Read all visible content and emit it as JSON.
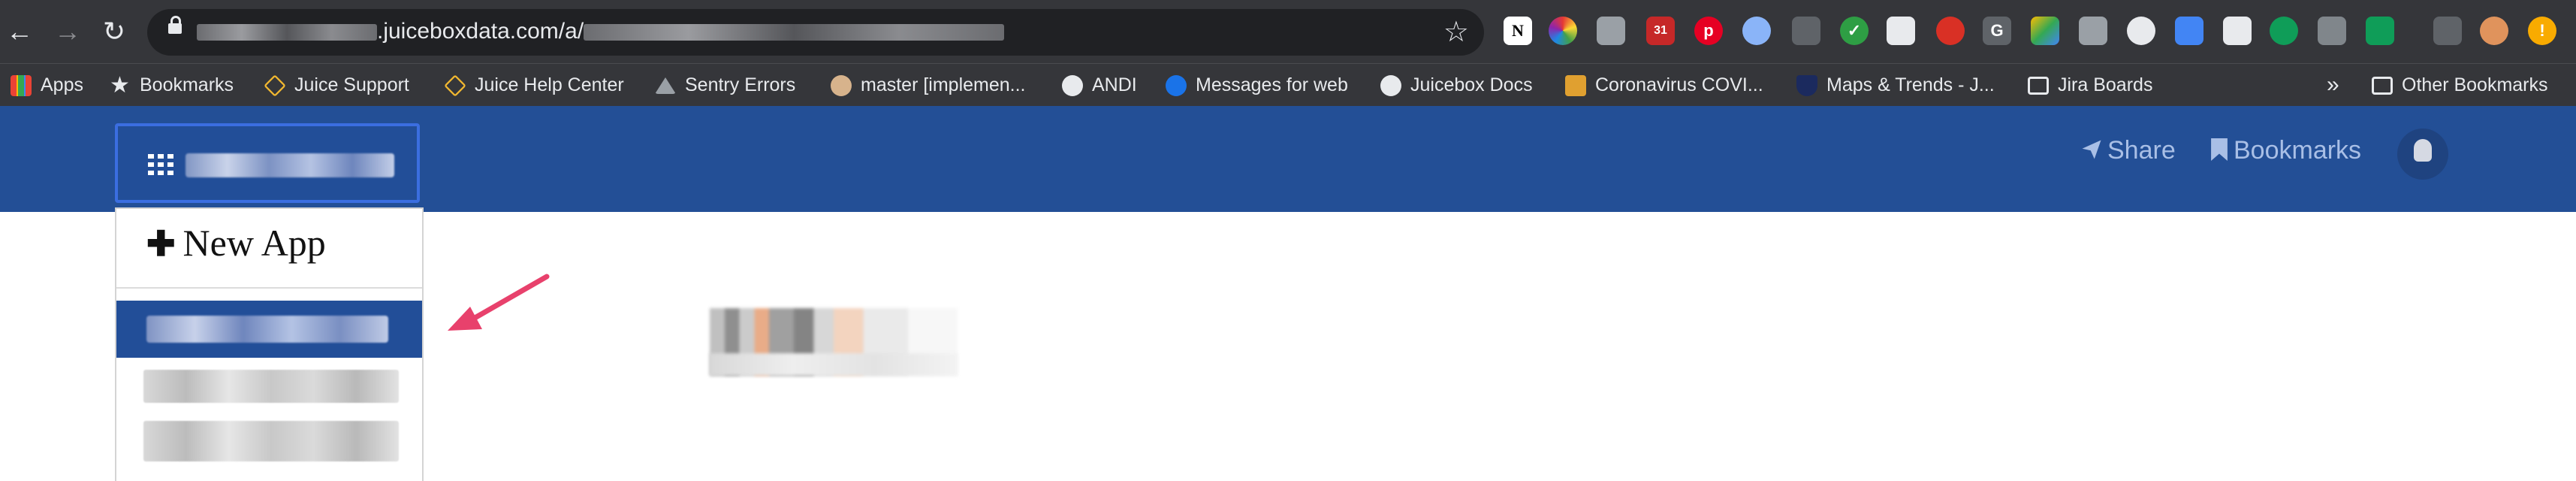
{
  "browser": {
    "url_visible": ".juiceboxdata.com/a/",
    "nav": {
      "back": "←",
      "forward": "→",
      "reload": "↻"
    },
    "star_icon": "☆"
  },
  "bookmarks": [
    {
      "label": "Apps",
      "icon": "apps-grid-icon"
    },
    {
      "label": "Bookmarks",
      "icon": "star-icon"
    },
    {
      "label": "Juice Support",
      "icon": "juice-diamond-icon"
    },
    {
      "label": "Juice Help Center",
      "icon": "juice-diamond-icon"
    },
    {
      "label": "Sentry Errors",
      "icon": "sentry-icon"
    },
    {
      "label": "master [implemen...",
      "icon": "jenkins-icon"
    },
    {
      "label": "ANDI",
      "icon": "globe-icon"
    },
    {
      "label": "Messages for web",
      "icon": "messages-icon"
    },
    {
      "label": "Juicebox Docs",
      "icon": "globe-icon"
    },
    {
      "label": "Coronavirus COVI...",
      "icon": "covid-icon"
    },
    {
      "label": "Maps & Trends - J...",
      "icon": "shield-icon"
    },
    {
      "label": "Jira Boards",
      "icon": "folder-icon"
    }
  ],
  "bookmarks_more": "»",
  "other_bookmarks": "Other Bookmarks",
  "extension_badge": "31",
  "header": {
    "share_label": "Share",
    "bookmarks_label": "Bookmarks"
  },
  "dropdown": {
    "new_app_plus": "✚",
    "new_app_label": "New App"
  },
  "colors": {
    "header_bg": "#234f96",
    "selected_item_bg": "#224e98",
    "arrow": "#e8416c",
    "chrome_toolbar": "#35363a"
  }
}
